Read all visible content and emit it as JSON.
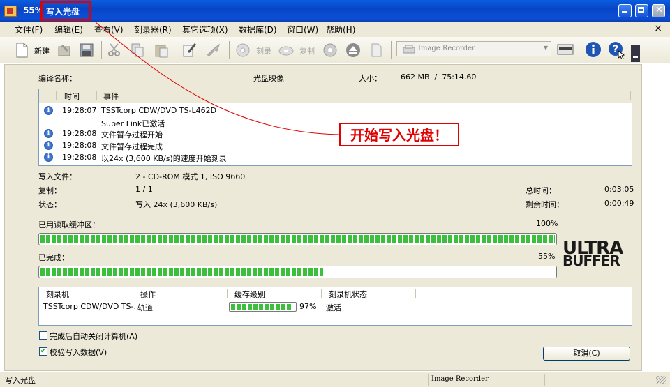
{
  "window": {
    "percent": "55%",
    "title": "写入光盘"
  },
  "menu": {
    "items": [
      "文件(F)",
      "编辑(E)",
      "查看(V)",
      "刻录器(R)",
      "其它选项(X)",
      "数据库(D)",
      "窗口(W)",
      "帮助(H)"
    ],
    "close": "×"
  },
  "toolbar": {
    "new_label": "新建",
    "burn_label": "刻录",
    "copy_label": "复制",
    "recorder": "Image Recorder"
  },
  "compile": {
    "name_label": "编译名称：",
    "name_value": "光盘映像",
    "size_label": "大小：",
    "size_value": "662 MB  /  75:14.60"
  },
  "log": {
    "columns": [
      "时间",
      "事件"
    ],
    "rows": [
      {
        "time": "19:28:07",
        "event": "TSSTcorp CDW/DVD TS-L462D"
      },
      {
        "time": "",
        "event": "Super Link已激活"
      },
      {
        "time": "19:28:08",
        "event": "文件暂存过程开始"
      },
      {
        "time": "19:28:08",
        "event": "文件暂存过程完成"
      },
      {
        "time": "19:28:08",
        "event": "以24x (3,600 KB/s)的速度开始刻录"
      }
    ]
  },
  "details": {
    "write_file_label": "写入文件：",
    "write_file_value": "2 - CD-ROM 模式 1, ISO 9660",
    "copy_label": "复制：",
    "copy_value": "1 / 1",
    "status_label": "状态：",
    "status_value": "写入 24x (3,600 KB/s)",
    "total_time_label": "总时间：",
    "total_time_value": "0:03:05",
    "remaining_label": "剩余时间：",
    "remaining_value": "0:00:49"
  },
  "buffer": {
    "label": "已用读取缓冲区：",
    "percent_text": "100%",
    "fraction": 1.0
  },
  "completed": {
    "label": "已完成：",
    "percent_text": "55%",
    "fraction": 0.55
  },
  "logo": {
    "line1": "ULTRA",
    "line2": "BUFFER"
  },
  "recorders": {
    "columns": [
      "刻录机",
      "操作",
      "缓存级别",
      "刻录机状态"
    ],
    "row": {
      "recorder": "TSSTcorp CDW/DVD TS-...",
      "operation": "轨道",
      "cache_text": "97%",
      "cache_fraction": 0.97,
      "status": "激活"
    }
  },
  "options": {
    "shutdown_label": "完成后自动关闭计算机(A)",
    "shutdown_checked": false,
    "verify_label": "校验写入数据(V)",
    "verify_checked": true
  },
  "cancel_label": "取消(C)",
  "statusbar": {
    "left": "写入光盘",
    "center": "Image Recorder"
  },
  "annotation": {
    "text": "开始写入光盘！"
  },
  "colors": {
    "titlebar": "#0a5ee0",
    "progress": "#3cbf3c",
    "annotation": "#e00000",
    "face": "#ece9d8"
  }
}
